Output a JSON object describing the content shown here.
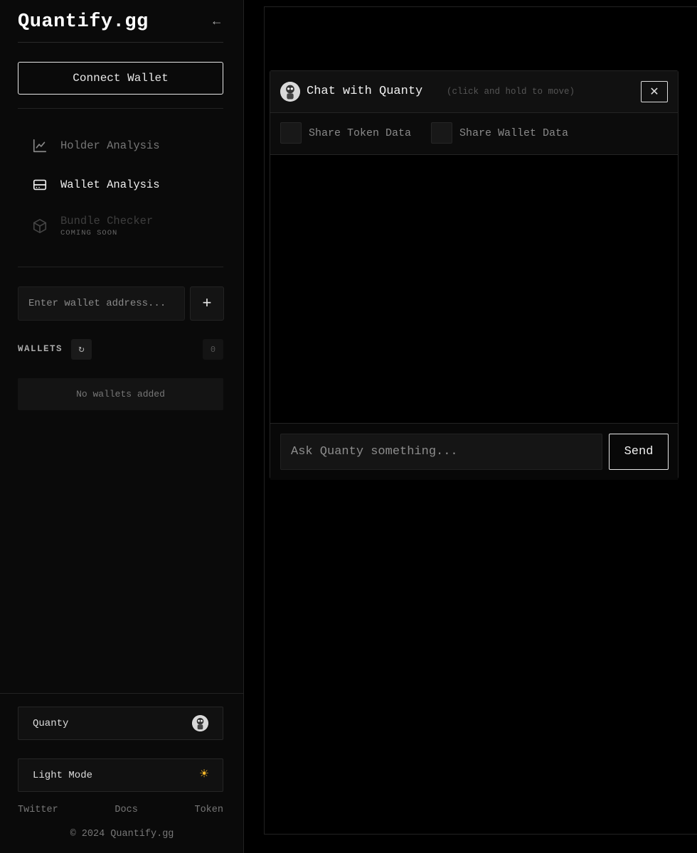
{
  "brand": {
    "title": "Quantify.gg",
    "collapse_glyph": "←"
  },
  "sidebar": {
    "connect_wallet": "Connect Wallet",
    "nav": [
      {
        "label": "Holder Analysis",
        "icon": "line-chart-icon"
      },
      {
        "label": "Wallet Analysis",
        "icon": "wallet-card-icon"
      },
      {
        "label": "Bundle Checker",
        "sub": "COMING SOON",
        "icon": "cube-icon"
      }
    ],
    "address_placeholder": "Enter wallet address...",
    "add_glyph": "+",
    "wallets_label": "WALLETS",
    "refresh_glyph": "↻",
    "wallet_count": "0",
    "empty_text": "No wallets added"
  },
  "footer": {
    "quanty_label": "Quanty",
    "light_mode_label": "Light Mode",
    "sun_glyph": "☀",
    "links": [
      "Twitter",
      "Docs",
      "Token"
    ],
    "copyright": "© 2024 Quantify.gg"
  },
  "chat": {
    "title": "Chat with Quanty",
    "hint": "(click and hold to move)",
    "close_glyph": "✕",
    "share_token": "Share Token Data",
    "share_wallet": "Share Wallet Data",
    "input_placeholder": "Ask Quanty something...",
    "send_label": "Send"
  },
  "colors": {
    "background": "#000000",
    "sidebar": "#0a0a0a",
    "accent_sun": "#f5b82a"
  }
}
